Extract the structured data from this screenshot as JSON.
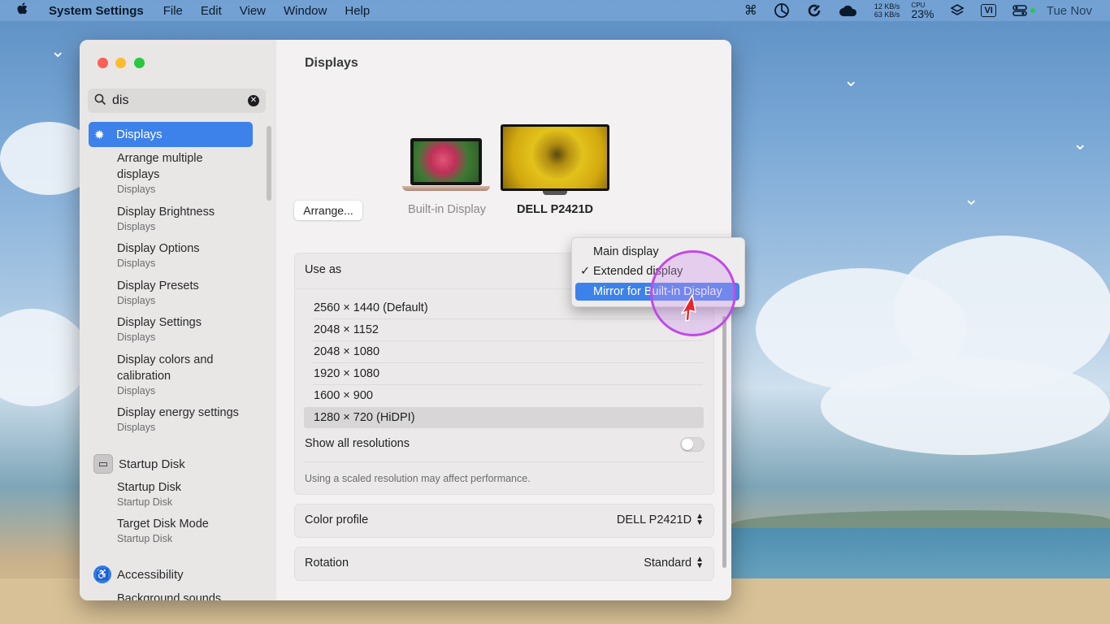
{
  "menubar": {
    "app_name": "System Settings",
    "items": [
      "File",
      "Edit",
      "View",
      "Window",
      "Help"
    ],
    "net_up": "12 KB/s",
    "net_down": "63 KB/s",
    "cpu_label": "CPU",
    "cpu_value": "23%",
    "vi_label": "VI",
    "clock": "Tue Nov",
    "icons": [
      "apple-icon",
      "command-icon",
      "wheel-icon",
      "refresh-icon",
      "cloud-icon",
      "layers-icon",
      "control-center-icon"
    ]
  },
  "sidebar": {
    "search_value": "dis",
    "selected_item": "Displays",
    "results": [
      {
        "title": "Arrange multiple displays",
        "title_line1": "Arrange multiple",
        "title_line2": "displays",
        "subtitle": "Displays"
      },
      {
        "title": "Display Brightness",
        "subtitle": "Displays"
      },
      {
        "title": "Display Options",
        "subtitle": "Displays"
      },
      {
        "title": "Display Presets",
        "subtitle": "Displays"
      },
      {
        "title": "Display Settings",
        "subtitle": "Displays"
      },
      {
        "title_line1": "Display colors and",
        "title_line2": "calibration",
        "subtitle": "Displays"
      },
      {
        "title": "Display energy settings",
        "subtitle": "Displays"
      },
      {
        "title": "Startup Disk",
        "subtitle": "Startup Disk"
      },
      {
        "title": "Target Disk Mode",
        "subtitle": "Startup Disk"
      },
      {
        "title": "Background sounds"
      }
    ],
    "categories": [
      "Startup Disk",
      "Accessibility"
    ]
  },
  "main": {
    "title": "Displays",
    "arrange_button": "Arrange...",
    "displays": [
      "Built-in Display",
      "DELL P2421D"
    ],
    "selected_display": "DELL P2421D",
    "use_as_label": "Use as",
    "resolutions": [
      "2560 × 1440 (Default)",
      "2048 × 1152",
      "2048 × 1080",
      "1920 × 1080",
      "1600 × 900",
      "1280 × 720 (HiDPI)"
    ],
    "selected_resolution": "1280 × 720 (HiDPI)",
    "show_all_label": "Show all resolutions",
    "show_all_on": false,
    "note": "Using a scaled resolution may affect performance.",
    "color_profile_label": "Color profile",
    "color_profile_value": "DELL P2421D",
    "rotation_label": "Rotation",
    "rotation_value": "Standard"
  },
  "use_as_menu": {
    "options": [
      "Main display",
      "Extended display",
      "Mirror for Built-in Display"
    ],
    "checked": "Extended display",
    "highlighted": "Mirror for Built-in Display"
  },
  "colors": {
    "accent": "#3d82ea",
    "cursor_ring": "#c04be6",
    "cursor": "#e8262a"
  }
}
